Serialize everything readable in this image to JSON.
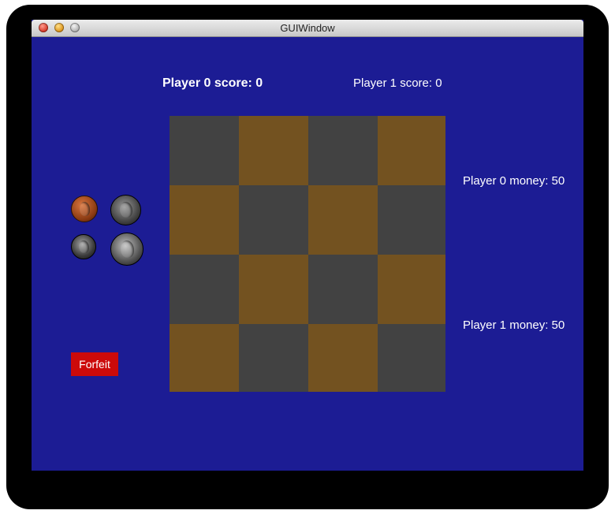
{
  "window": {
    "title": "GUIWindow",
    "background_color": "#1c1c94"
  },
  "scores": {
    "player0": "Player 0 score: 0",
    "player1": "Player 1 score: 0"
  },
  "money": {
    "player0": "Player 0 money: 50",
    "player1": "Player 1 money: 50"
  },
  "board": {
    "rows": 4,
    "cols": 4,
    "dark_color": "#424242",
    "light_color": "#735220",
    "pattern": [
      [
        "dark",
        "light",
        "dark",
        "light"
      ],
      [
        "light",
        "dark",
        "light",
        "dark"
      ],
      [
        "dark",
        "light",
        "dark",
        "light"
      ],
      [
        "light",
        "dark",
        "light",
        "dark"
      ]
    ]
  },
  "coins": [
    {
      "name": "penny-icon"
    },
    {
      "name": "nickel-icon"
    },
    {
      "name": "dime-icon"
    },
    {
      "name": "quarter-icon"
    }
  ],
  "buttons": {
    "forfeit_label": "Forfeit",
    "forfeit_color": "#cc0a0a"
  }
}
